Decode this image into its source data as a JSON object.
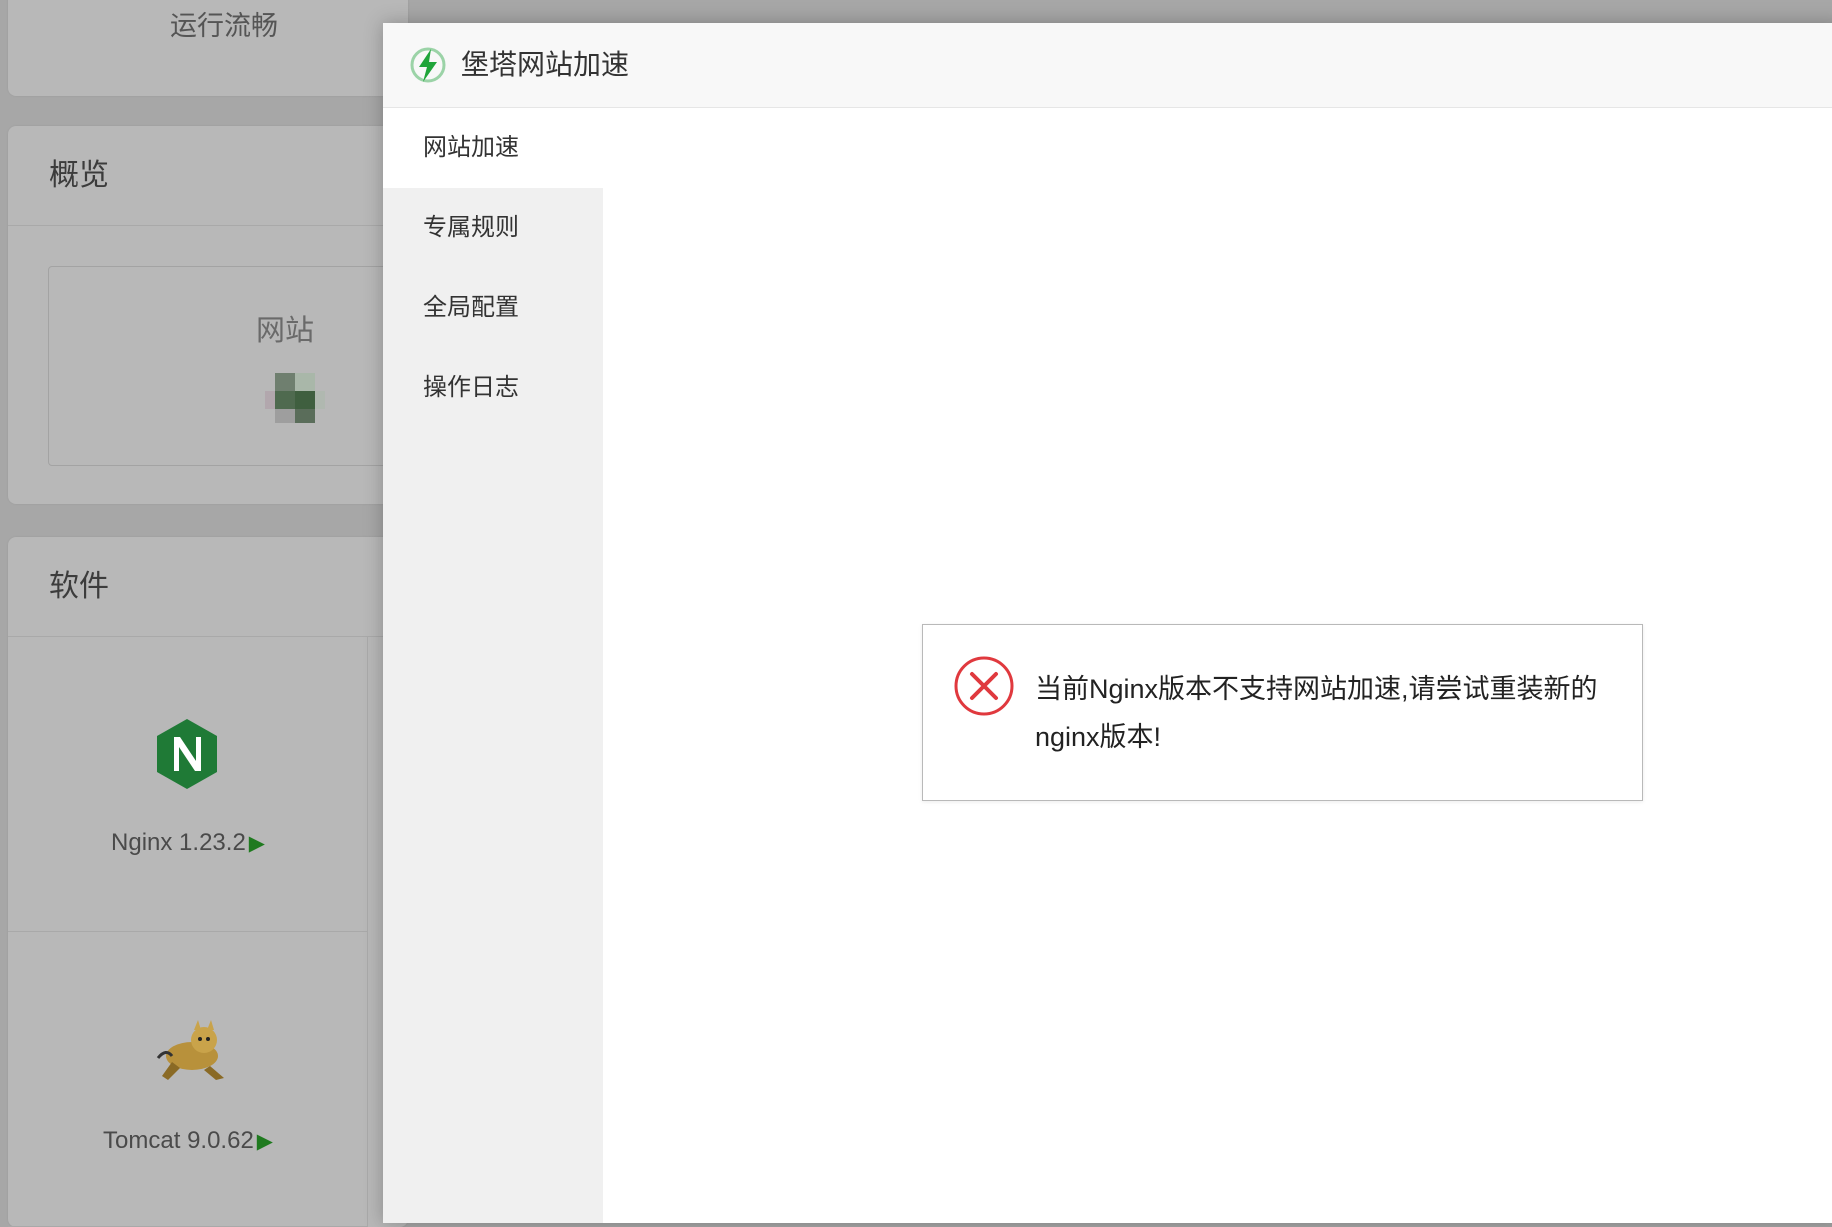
{
  "background": {
    "status_text": "运行流畅",
    "overview": {
      "title": "概览",
      "site_label": "网站"
    },
    "software": {
      "title": "软件",
      "items": [
        {
          "name": "Nginx 1.23.2",
          "icon": "nginx-logo-icon"
        },
        {
          "name": "Tomcat 9.0.62",
          "icon": "tomcat-logo-icon"
        }
      ]
    }
  },
  "modal": {
    "title": "堡塔网站加速",
    "logo_icon": "lightning-icon",
    "nav": [
      {
        "label": "网站加速",
        "active": true
      },
      {
        "label": "专属规则",
        "active": false
      },
      {
        "label": "全局配置",
        "active": false
      },
      {
        "label": "操作日志",
        "active": false
      }
    ]
  },
  "alert": {
    "icon": "error-circle-icon",
    "message": "当前Nginx版本不支持网站加速,请尝试重装新的nginx版本!"
  },
  "colors": {
    "overlay": "#a7a7a7",
    "accent_green": "#20a53a",
    "error_red": "#e0393e",
    "nav_bg": "#f0f0f0"
  }
}
